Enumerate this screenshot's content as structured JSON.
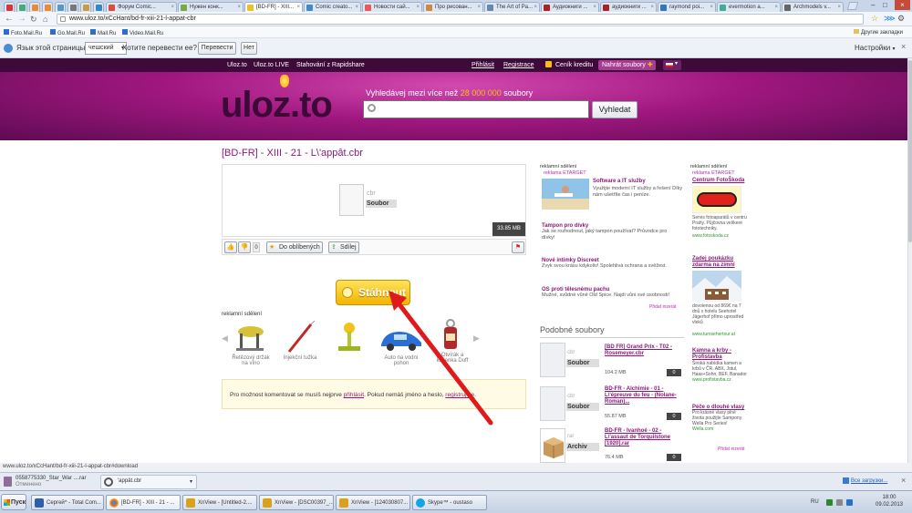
{
  "browser": {
    "tabs": [
      {
        "label": "Форум Comic..."
      },
      {
        "label": "Нужен конк..."
      },
      {
        "label": "[BD-FR] - XIII..."
      },
      {
        "label": "Comic creato..."
      },
      {
        "label": "Новости сай..."
      },
      {
        "label": "Про рисован..."
      },
      {
        "label": "The Art of Pa..."
      },
      {
        "label": "Аудиокниги ..."
      },
      {
        "label": "аудиокниги ..."
      },
      {
        "label": "raymond poi..."
      },
      {
        "label": "evermotion a..."
      },
      {
        "label": "Archmodels v..."
      }
    ],
    "url": "www.uloz.to/xCcHant/bd-fr-xiii-21-l-appat-cbr",
    "bookmarks": [
      "Foto.Mail.Ru",
      "Go.Mail.Ru",
      "Mail.Ru",
      "Video.Mail.Ru"
    ],
    "other_bookmarks": "Другие закладки",
    "translate": {
      "prefix": "Язык этой страницы:",
      "language": "чешский",
      "question": "Хотите перевести ее?",
      "translate_btn": "Перевести",
      "no_btn": "Нет",
      "settings": "Настройки"
    },
    "status_url": "www.uloz.to/xCcHant/bd-fr-xiii-21-l-appat-cbr#download"
  },
  "site": {
    "nav": {
      "home": "Uloz.to",
      "live": "Uloz.to LIVE",
      "rapidshare": "Stahování z Rapidshare",
      "login": "Přihlásit",
      "register": "Registrace",
      "credit": "Ceník kreditu",
      "upload": "Nahrát soubory"
    },
    "logo": "uloz.to",
    "search_prompt_pre": "Vyhledávej mezi více než ",
    "search_count": "28 000 000",
    "search_prompt_post": " soubory",
    "search_btn": "Vyhledat",
    "file_title": "[BD-FR] - XIII - 21 - L\\'appât.cbr",
    "file_ext": "cbr",
    "file_type": "Soubor",
    "file_size": "33.85 MB",
    "rating": "0",
    "favorites": "Do oblíbených",
    "share": "Sdílej",
    "download": "Stáhnout",
    "ads_label": "reklamní sdělení",
    "products": [
      {
        "name": "Řetězový držák na víno"
      },
      {
        "name": "Injekční tužka"
      },
      {
        "name": ""
      },
      {
        "name": "Auto na vodní pohon"
      },
      {
        "name": "Otvírák a klíčenka Duff"
      }
    ],
    "comment_pre": "Pro možnost komentovat se musíš nejprve ",
    "comment_login": "přihlásit",
    "comment_mid": ". Pokud nemáš jméno a heslo, ",
    "comment_register": "registruj se",
    "comment_post": ".",
    "mid_ads": {
      "label": "reklamní sdělení",
      "sublabel": "reklama ETARGET",
      "items": [
        {
          "title": "Software a IT služby",
          "text": "Využijte moderní IT služby a řešení Díky nám ušetříte čas i peníze."
        },
        {
          "title": "Tampon pro dívky",
          "text": "Jak se rozhodnout, jaký tampon používat? Průvodce pro dívky!"
        },
        {
          "title": "Nové intimky Discreet",
          "text": "Zvyk svou krásu kdykoliv! Spolehlivá ochrana a svěžest."
        },
        {
          "title": "OS proti tělesnému pachu",
          "text": "Mužné, svůdné vůně Old Spice. Najdi vůni své osobnosti!"
        }
      ],
      "footer": "Přidat inzerát"
    },
    "similar": {
      "heading": "Podobné soubory",
      "items": [
        {
          "ext": "cbr",
          "type": "Soubor",
          "title": "[BD FR] Grand Prix - T02 - Rosemeyer.cbr",
          "size": "104.2 MB",
          "count": "0"
        },
        {
          "ext": "cbr",
          "type": "Soubor",
          "title": "BD-FR - Alchimie - 01 - L\\'épreuve du feu - (Nolane-Roman)...",
          "size": "55.87 MB",
          "count": "0"
        },
        {
          "ext": "rar",
          "type": "Archiv",
          "title": "BD-FR - Ivanhoé - 02 - L\\'assaut de Torquilstone [1920].rar",
          "size": "76.4 MB",
          "count": "0"
        }
      ]
    },
    "right_ads": {
      "label": "reklamní sdělení",
      "sublabel": "reklama ETARGET",
      "items": [
        {
          "title": "Centrum FotoŠkoda",
          "text": "Servis fotoaparátů v centru Prahy. Půjčovna veškeré fototechniky.",
          "url": "www.fotoskoda.cz"
        },
        {
          "title": "Zadej poukázku zdarma na zimní",
          "text": "dovolenou od 869€ na 7 dnů v hotelu Seehotel Jägerhof přímo uprostřed vleků",
          "url": "www.turnsehertour.at"
        },
        {
          "title": "Kamna a krby - Profistavba",
          "text": "Široká nabídka kamen a krbů v ČR. ABX, Jotul, Haas+Sohn, BEF, Banador",
          "url": "www.profistavba.cz"
        },
        {
          "title": "Péče o dlouhé vlasy",
          "text": "Pro krásné vlasy plné života použijte Sampony Wella Pro Series!",
          "url": "Wella.com"
        }
      ],
      "footer": "Přidat inzerát"
    }
  },
  "downloads": {
    "items": [
      {
        "name": "0558775330_Star_War ....rar",
        "status": "Отменено"
      },
      {
        "name": "'appât.cbr"
      }
    ],
    "all": "Все загрузки..."
  },
  "taskbar": {
    "start": "Пуск",
    "tasks": [
      {
        "label": "Сергей^ - Total Com..."
      },
      {
        "label": "[BD-FR] - XIII - 21 - ..."
      },
      {
        "label": "XnView - [Untitled-2...."
      },
      {
        "label": "XnView - [DSC00397_..."
      },
      {
        "label": "XnView - [124030807..."
      },
      {
        "label": "Skype™ - oustaso"
      }
    ],
    "lang": "RU",
    "time": "18:00",
    "date": "09.02.2013"
  }
}
